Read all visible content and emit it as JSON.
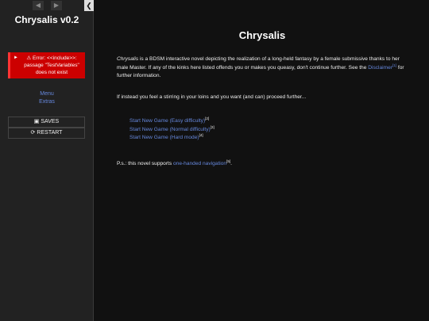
{
  "sidebar": {
    "title": "Chrysalis v0.2",
    "history": {
      "back_icon": "arrow-left-icon",
      "forward_icon": "arrow-right-icon"
    },
    "stow_icon": "chevron-left-icon",
    "error": {
      "icon": "warning-icon",
      "line1": "Error: <<include>>:",
      "line2": "passage \"TestVariables\"",
      "line3": "does not exist"
    },
    "links": [
      "Menu",
      "Extras"
    ],
    "saves_label": "SAVES",
    "restart_label": "RESTART"
  },
  "passage": {
    "title": "Chrysalis",
    "intro_em": "Chrysalis",
    "intro_text": " is a BDSM interactive novel depicting the realization of a long-held fantasy by a female submissive thanks to her male Master. If any of the kinks here listed offends you or makes you queasy, don't continue further. See the ",
    "disclaimer_link": "Disclaimer",
    "disclaimer_ref": "[1]",
    "intro_tail": " for further information.",
    "stirring": "If instead you feel a stirring in your loins and you want (and can) proceed further...",
    "start_links": [
      {
        "label": "Start New Game (Easy difficulty)",
        "ref": "[2]"
      },
      {
        "label": "Start New Game (Normal difficulty)",
        "ref": "[3]"
      },
      {
        "label": "Start New Game (Hard mode)",
        "ref": "[4]"
      }
    ],
    "ps_text": "P.s.: this novel supports ",
    "ps_link": "one-handed navigation",
    "ps_ref": "[5]",
    "ps_tail": "."
  },
  "colors": {
    "link": "#6688dd",
    "error_bg": "#cc0000",
    "sidebar_bg": "#222222",
    "page_bg": "#111111"
  }
}
